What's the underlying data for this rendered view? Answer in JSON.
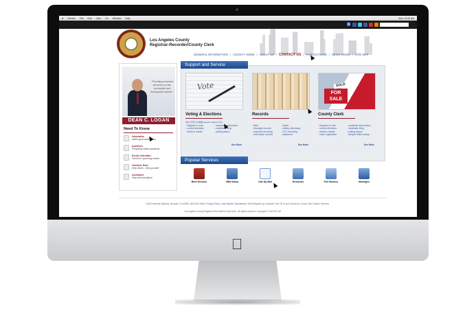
{
  "menubar": {
    "items": [
      "Reeder",
      "File",
      "Edit",
      "View",
      "Go",
      "Window",
      "Help"
    ],
    "clock": "Mon 12:00 AM"
  },
  "header": {
    "org_line1": "Los Angeles County",
    "org_line2": "Registrar-Recorder/County Clerk"
  },
  "topnav": {
    "items": [
      "GENERAL INFORMATION",
      "COUNTY HOME",
      "ABOUT US",
      "CONTACT US",
      "PUBLICATIONS",
      "NEWS ROOM",
      "SITE MAP"
    ],
    "active": "CONTACT US"
  },
  "profile": {
    "quote": "\"Providing essential services in a fair, accessible and transparent manner.\"",
    "name": "DEAN C. LOGAN"
  },
  "need_to_know": {
    "title": "Need To Know",
    "items": [
      {
        "head": "Information",
        "text": "useful government links."
      },
      {
        "head": "Questions",
        "text": "Frequently asked questions."
      },
      {
        "head": "Events Calendars",
        "text": "Check for upcoming events."
      },
      {
        "head": "Volunteer Now!",
        "text": "Help others - Help yourself"
      },
      {
        "head": "Assistance",
        "text": "Help with translation"
      }
    ]
  },
  "support": {
    "title": "Support and Service",
    "see_more": "See More",
    "cards": [
      {
        "title": "Voting & Elections",
        "languages": "中文  한국어  日本語  Español  Tagalog  ไทย",
        "col1": [
          "- Register to vote",
          "- current elections",
          "- election results"
        ],
        "col2": [
          "- candidate information",
          "- candidate filing",
          "- polling places"
        ]
      },
      {
        "title": "Records",
        "col1": [
          "- Birth",
          "- Marriage records",
          "- property recording",
          "- real estate records"
        ],
        "col2": [
          "- Death",
          "- military discharge",
          "- UCC financing",
          "- statement"
        ]
      },
      {
        "title": "County Clerk",
        "col1": [
          "- Register to vote",
          "- current elections",
          "- election results",
          "- voter registration"
        ],
        "col2": [
          "- candidate information",
          "- candidate filing",
          "- polling places",
          "- sample ballot lookup"
        ]
      }
    ],
    "image_text": {
      "vote": "Vote",
      "forsale": "FOR SALE",
      "sold": "SOLD"
    }
  },
  "popular": {
    "title": "Popular Services",
    "services": [
      "Birth Records",
      "VBM Status",
      "Vote By Mail",
      "Residents",
      "Poll Workers",
      "Marriages"
    ]
  },
  "footer": {
    "line1_left": "12400 Imperial Highway, Norwalk, CA 90650 | 800-815-2666",
    "line1_links": [
      "Privacy Policy",
      "User Rights",
      "Disclaimers"
    ],
    "line1_right": "Site designed by Computer Tech 2012 and owned by County Clerk Search Services",
    "line2": "Los Angeles County Registrar-Recorder/County Clerk - All rights reserved. Copyright © LAVOTE.net"
  },
  "colors": {
    "accent_red": "#8e1f2f",
    "link_blue": "#3b5da0",
    "header_blue": "#1e4a8e"
  }
}
